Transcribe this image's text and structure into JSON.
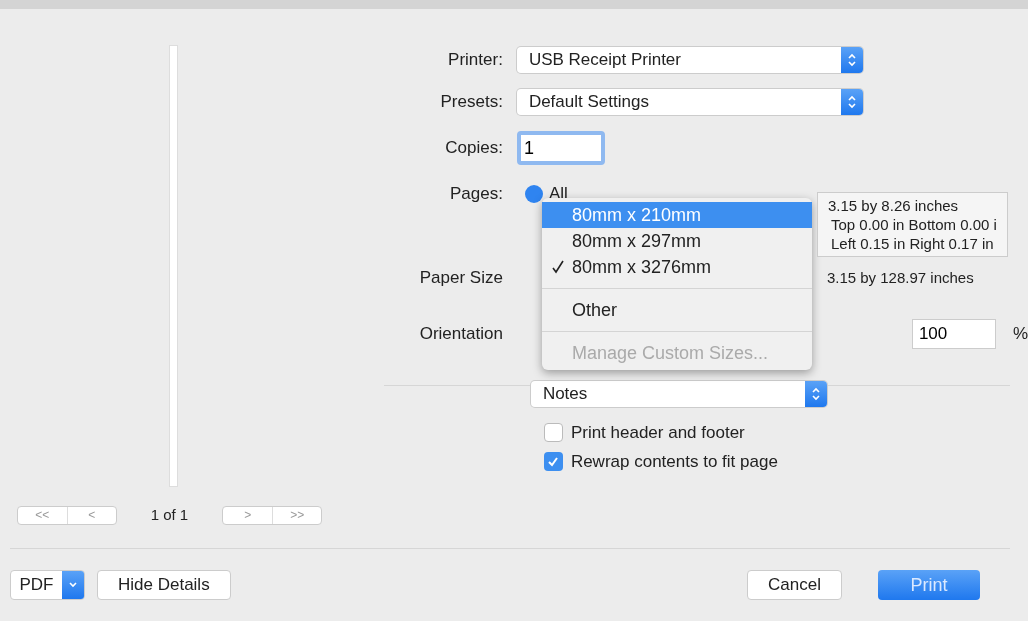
{
  "printer": {
    "label": "Printer:",
    "value": "USB Receipt Printer"
  },
  "presets": {
    "label": "Presets:",
    "value": "Default Settings"
  },
  "copies": {
    "label": "Copies:",
    "value": "1"
  },
  "pages": {
    "label": "Pages:",
    "option": "All",
    "selected": true
  },
  "paper_size": {
    "label": "Paper Size",
    "info": "3.15 by 128.97 inches"
  },
  "orientation": {
    "label": "Orientation"
  },
  "scale": {
    "value": "100",
    "unit": "%"
  },
  "section_select": {
    "value": "Notes"
  },
  "options": [
    {
      "label": "Print header and footer",
      "checked": false
    },
    {
      "label": "Rewrap contents to fit page",
      "checked": true
    }
  ],
  "preview": {
    "nav_back": [
      "<<",
      "<"
    ],
    "page_indicator": "1 of 1",
    "nav_forward": [
      ">",
      ">>"
    ]
  },
  "footer": {
    "pdf": "PDF",
    "hide_details": "Hide Details",
    "cancel": "Cancel",
    "print": "Print"
  },
  "paper_menu": [
    {
      "kind": "item",
      "label": "80mm x 210mm",
      "selected": true,
      "checked": false,
      "disabled": false
    },
    {
      "kind": "item",
      "label": "80mm x 297mm",
      "selected": false,
      "checked": false,
      "disabled": false
    },
    {
      "kind": "item",
      "label": "80mm x 3276mm",
      "selected": false,
      "checked": true,
      "disabled": false
    },
    {
      "kind": "separator"
    },
    {
      "kind": "item",
      "label": "Other",
      "selected": false,
      "checked": false,
      "disabled": false
    },
    {
      "kind": "separator"
    },
    {
      "kind": "item",
      "label": "Manage Custom Sizes...",
      "selected": false,
      "checked": false,
      "disabled": true
    }
  ],
  "tooltip": [
    "3.15 by 8.26 inches",
    "Top 0.00 in Bottom 0.00 i",
    "Left 0.15 in Right 0.17 in"
  ]
}
